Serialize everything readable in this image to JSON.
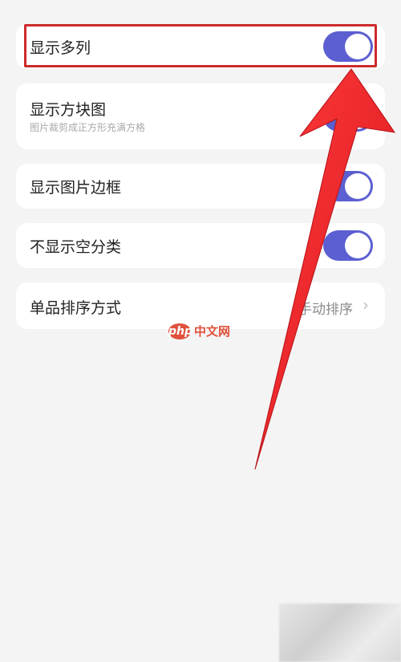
{
  "settings": {
    "rows": [
      {
        "label": "显示多列",
        "toggle": "on"
      },
      {
        "label": "显示方块图",
        "sub": "图片裁剪成正方形充满方格",
        "toggle": "on"
      },
      {
        "label": "显示图片边框",
        "toggle": "on"
      },
      {
        "label": "不显示空分类",
        "toggle": "on"
      },
      {
        "label": "单品排序方式",
        "value": "手动排序"
      }
    ]
  },
  "watermark": {
    "logo": "php",
    "text": "中文网"
  },
  "annotation": {
    "arrow_color": "#e8242a",
    "box_color": "#cc2b2b"
  },
  "theme": {
    "toggle_on": "#5b5fd1"
  },
  "icons": {
    "chevron": "chevron-right-icon"
  }
}
